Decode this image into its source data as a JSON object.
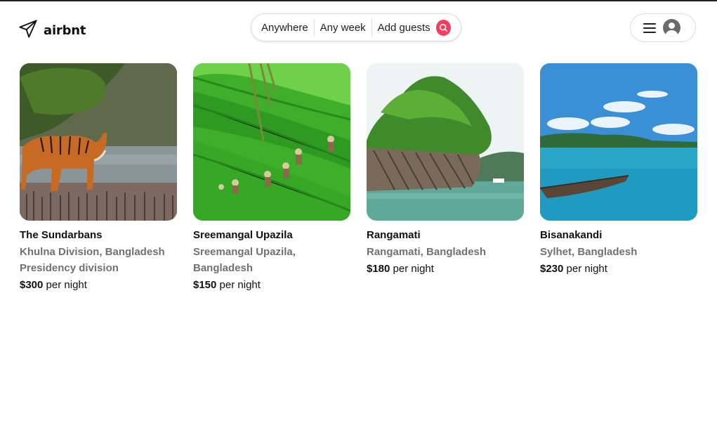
{
  "brand": {
    "name": "airbnt",
    "logo_icon": "paper-plane-icon"
  },
  "search": {
    "location": "Anywhere",
    "dates": "Any week",
    "guests": "Add guests",
    "button_icon": "search-icon",
    "accent_color": "#f43f5e"
  },
  "user_menu": {
    "menu_icon": "hamburger-icon",
    "avatar_icon": "user-avatar-icon"
  },
  "listings": [
    {
      "title": "The Sundarbans",
      "subtitle": "Khulna Division, Bangladesh Presidency division",
      "price": "$300",
      "price_unit": "per night",
      "image": "tiger-in-mangrove-image"
    },
    {
      "title": "Sreemangal Upazila",
      "subtitle": "Sreemangal Upazila, Bangladesh",
      "price": "$150",
      "price_unit": "per night",
      "image": "tea-garden-pickers-image"
    },
    {
      "title": "Rangamati",
      "subtitle": "Rangamati, Bangladesh",
      "price": "$180",
      "price_unit": "per night",
      "image": "lake-cliff-image"
    },
    {
      "title": "Bisanakandi",
      "subtitle": "Sylhet, Bangladesh",
      "price": "$230",
      "price_unit": "per night",
      "image": "river-boat-image"
    }
  ]
}
